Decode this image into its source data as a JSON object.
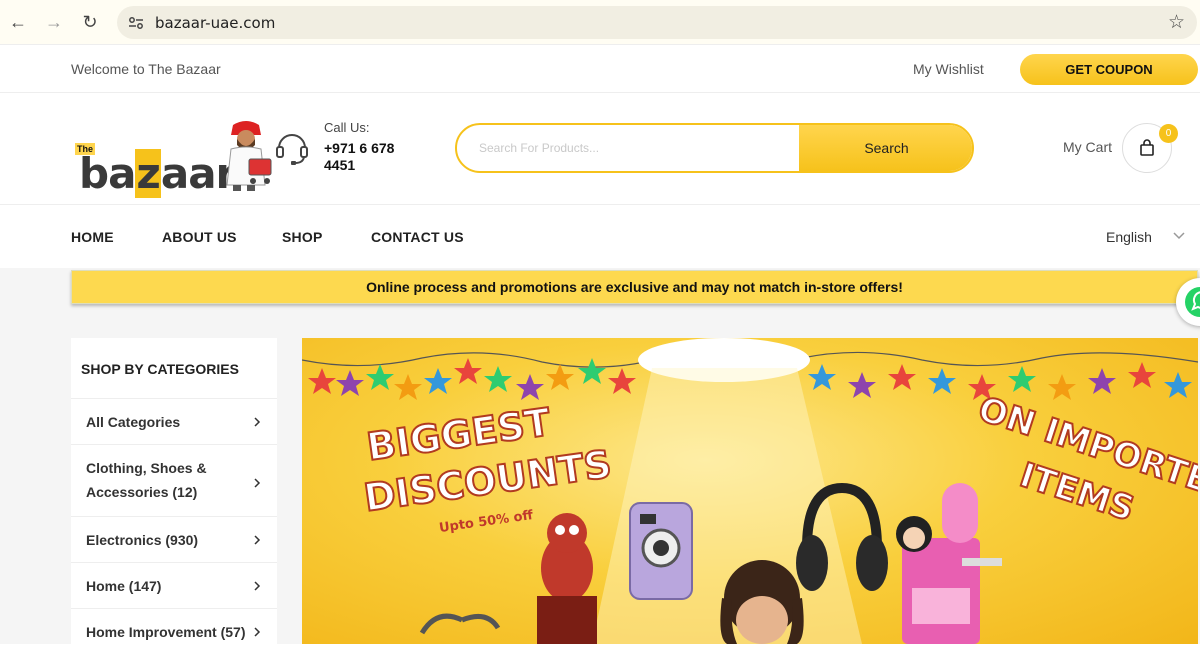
{
  "browser": {
    "url": "bazaar-uae.com"
  },
  "topbar": {
    "welcome": "Welcome to The Bazaar",
    "wishlist": "My Wishlist",
    "coupon": "GET COUPON"
  },
  "header": {
    "logo_the": "The",
    "logo_b": "b",
    "logo_a1": "a",
    "logo_z": "z",
    "logo_rest": "aar",
    "call_label": "Call Us:",
    "call_number": "+971 6 678 4451",
    "search_placeholder": "Search For Products...",
    "search_button": "Search",
    "cart_label": "My Cart",
    "cart_count": "0"
  },
  "nav": {
    "items": [
      "HOME",
      "ABOUT US",
      "SHOP",
      "CONTACT US"
    ],
    "language": "English"
  },
  "notice": "Online process and promotions are exclusive and may not match in-store offers!",
  "categories": {
    "title": "SHOP BY CATEGORIES",
    "items": [
      "All Categories",
      "Clothing, Shoes & Accessories (12)",
      "Electronics (930)",
      "Home (147)",
      "Home Improvement (57)"
    ]
  },
  "banner": {
    "left_line1": "BIGGEST",
    "left_line2": "DISCOUNTS",
    "left_sub": "Upto 50% off",
    "right_line1": "ON IMPORTED",
    "right_line2": "ITEMS"
  },
  "colors": {
    "accent": "#f6c21b",
    "notice_bg": "#fdd94f",
    "whatsapp": "#25d366"
  }
}
